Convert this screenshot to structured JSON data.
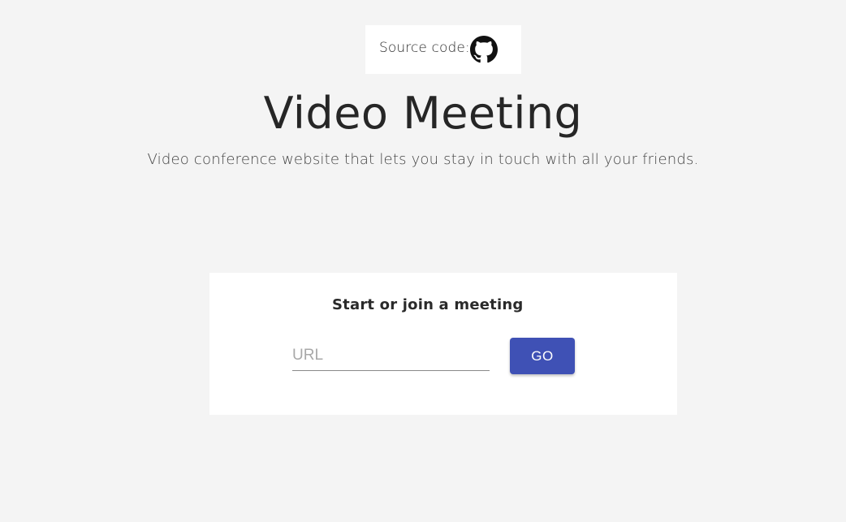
{
  "header": {
    "source_label": "Source code:",
    "source_icon": "github-icon"
  },
  "hero": {
    "title": "Video Meeting",
    "subtitle": "Video conference website that lets you stay in touch with all your friends."
  },
  "join_card": {
    "heading": "Start or join a meeting",
    "url_value": "",
    "url_placeholder": "URL",
    "go_label": "GO"
  },
  "colors": {
    "page_background": "#f4f4f4",
    "card_background": "#ffffff",
    "accent": "#3f51b5"
  }
}
